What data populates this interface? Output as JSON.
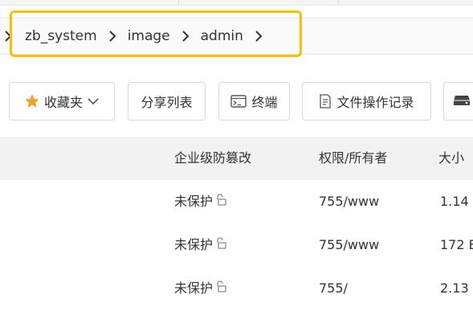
{
  "breadcrumb": {
    "items": [
      "zb_system",
      "image",
      "admin"
    ]
  },
  "toolbar": {
    "favorites_label": "收藏夹",
    "share_list_label": "分享列表",
    "terminal_label": "终端",
    "file_log_label": "文件操作记录"
  },
  "table": {
    "columns": {
      "tamper": "企业级防篡改",
      "perm_owner": "权限/所有者",
      "size": "大小"
    },
    "rows": [
      {
        "tamper": "未保护",
        "perm_owner": "755/www",
        "size": "1.14"
      },
      {
        "tamper": "未保护",
        "perm_owner": "755/www",
        "size": "172 E"
      },
      {
        "tamper": "未保护",
        "perm_owner": "755/",
        "size": "2.13"
      }
    ]
  },
  "colors": {
    "highlight": "#f6c000",
    "star": "#f5a623"
  }
}
